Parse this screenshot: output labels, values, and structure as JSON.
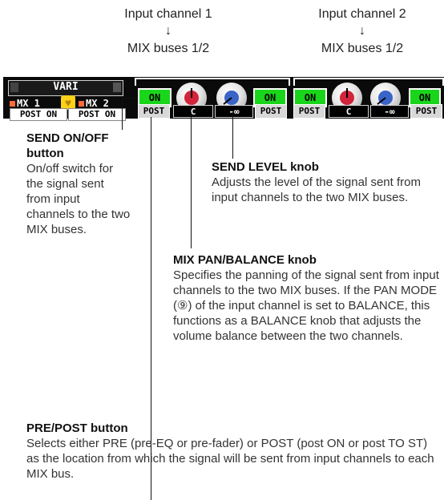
{
  "header": {
    "channel1_label": "Input channel 1",
    "channel2_label": "Input channel 2",
    "arrow": "↓",
    "bus1_label": "MIX buses 1/2",
    "bus2_label": "MIX buses 1/2"
  },
  "left_panel": {
    "vari_label": "VARI",
    "mx1_label": "MX 1",
    "mx2_label": "MX 2",
    "heart_glyph": "♥",
    "post_on_1": "POST ON",
    "post_on_2": "POST ON"
  },
  "channel1": {
    "on_left": "ON",
    "on_right": "ON",
    "post": "POST",
    "pan_readout": "C",
    "level_readout": "-∞"
  },
  "channel2": {
    "on_left": "ON",
    "on_right": "ON",
    "post": "POST",
    "post_right": "POST",
    "pan_readout": "C",
    "level_readout": "-∞"
  },
  "callouts": {
    "send_on_off": {
      "title": "SEND ON/OFF button",
      "desc": "On/off switch for the signal sent from input channels to the two MIX buses."
    },
    "send_level": {
      "title": "SEND LEVEL knob",
      "desc": "Adjusts the level of the signal sent from input channels to the two MIX buses."
    },
    "mix_pan": {
      "title": "MIX PAN/BALANCE knob",
      "desc": "Specifies the panning of the signal sent from input channels to the two MIX buses. If the PAN MODE (⑨) of the input channel is set to BALANCE, this functions as a BALANCE knob that adjusts the volume balance between the two channels."
    },
    "pre_post": {
      "title": "PRE/POST button",
      "desc": "Selects either PRE (pre-EQ or pre-fader) or POST (post ON or post TO ST) as the location from which the signal will be sent from input channels to each MIX bus."
    }
  },
  "colors": {
    "on_green": "#1ad61a",
    "pan_knob_red": "#d2243a",
    "level_knob_blue": "#3a64c8",
    "mx_orange": "#ff6a3a",
    "heart_yellow": "#ffd21a"
  }
}
